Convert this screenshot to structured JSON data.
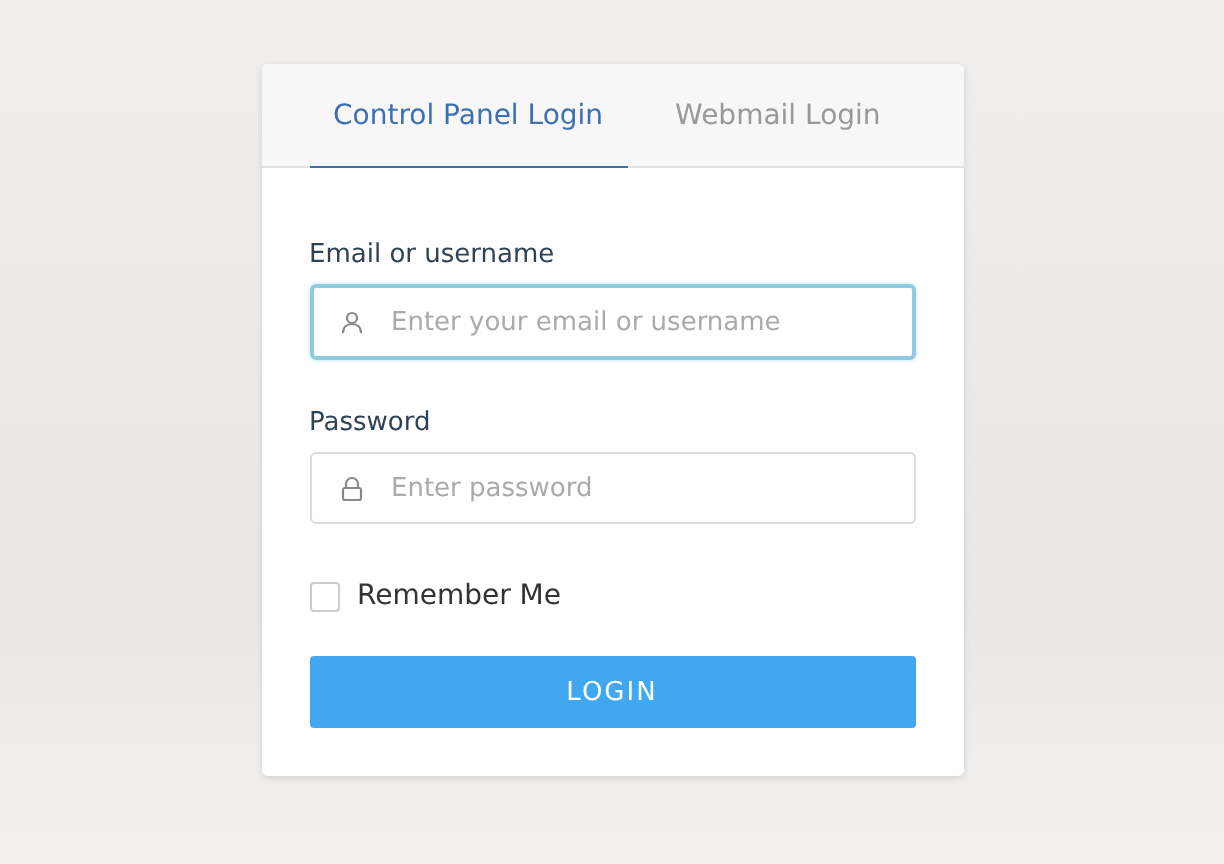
{
  "tabs": [
    {
      "label": "Control Panel Login",
      "selected": true
    },
    {
      "label": "Webmail Login",
      "selected": false
    }
  ],
  "fields": [
    {
      "kind": "user",
      "label": "Email or username",
      "placeholder": "Enter your email or username",
      "focused": true
    },
    {
      "kind": "lock",
      "label": "Password",
      "placeholder": "Enter password",
      "focused": false
    }
  ],
  "remember": {
    "label": "Remember Me",
    "checked": false
  },
  "button": "LOGIN"
}
